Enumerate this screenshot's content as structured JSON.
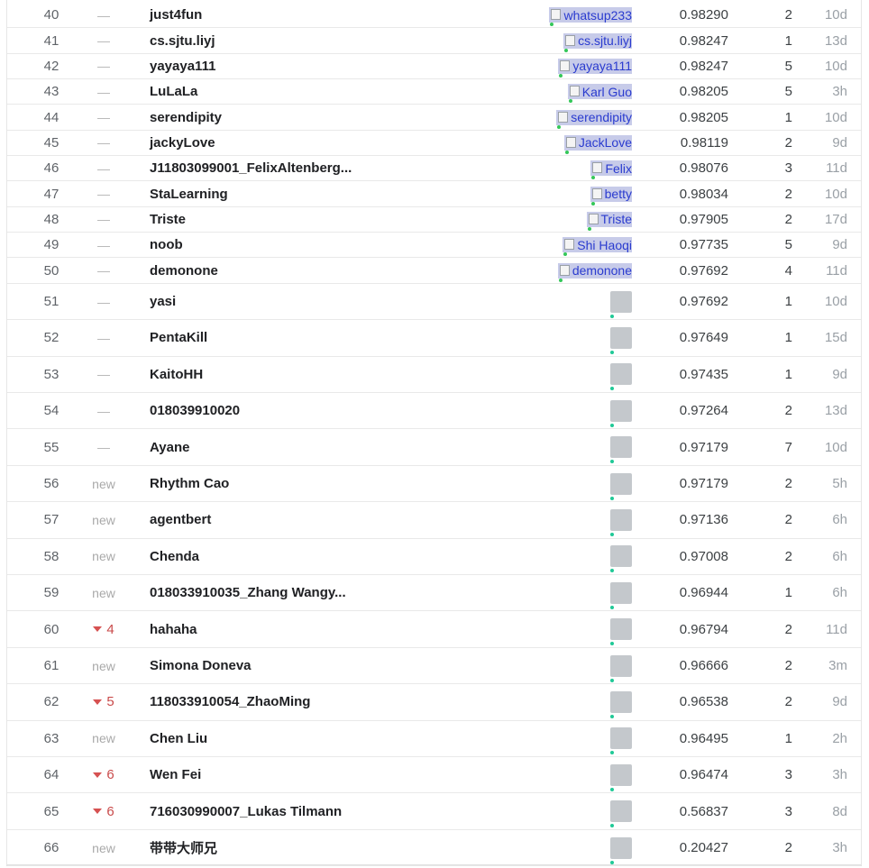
{
  "leaderboard": {
    "rows": [
      {
        "rank": "40",
        "change": "—",
        "team": "just4fun",
        "avatar_alt": "whatsup233",
        "score": "0.98290",
        "entries": "2",
        "last": "10d"
      },
      {
        "rank": "41",
        "change": "—",
        "team": "cs.sjtu.liyj",
        "avatar_alt": "cs.sjtu.liyj",
        "score": "0.98247",
        "entries": "1",
        "last": "13d"
      },
      {
        "rank": "42",
        "change": "—",
        "team": "yayaya111",
        "avatar_alt": "yayaya111",
        "score": "0.98247",
        "entries": "5",
        "last": "10d"
      },
      {
        "rank": "43",
        "change": "—",
        "team": "LuLaLa",
        "avatar_alt": "Karl Guo",
        "score": "0.98205",
        "entries": "5",
        "last": "3h"
      },
      {
        "rank": "44",
        "change": "—",
        "team": "serendipity",
        "avatar_alt": "serendipity",
        "score": "0.98205",
        "entries": "1",
        "last": "10d"
      },
      {
        "rank": "45",
        "change": "—",
        "team": "jackyLove",
        "avatar_alt": "JackLove",
        "score": "0.98119",
        "entries": "2",
        "last": "9d"
      },
      {
        "rank": "46",
        "change": "—",
        "team": "J11803099001_FelixAltenberg...",
        "avatar_alt": "Felix",
        "score": "0.98076",
        "entries": "3",
        "last": "11d"
      },
      {
        "rank": "47",
        "change": "—",
        "team": "StaLearning",
        "avatar_alt": "betty",
        "score": "0.98034",
        "entries": "2",
        "last": "10d"
      },
      {
        "rank": "48",
        "change": "—",
        "team": "Triste",
        "avatar_alt": "Triste",
        "score": "0.97905",
        "entries": "2",
        "last": "17d"
      },
      {
        "rank": "49",
        "change": "—",
        "team": "noob",
        "avatar_alt": "Shi Haoqi",
        "score": "0.97735",
        "entries": "5",
        "last": "9d"
      },
      {
        "rank": "50",
        "change": "—",
        "team": "demonone",
        "avatar_alt": "demonone",
        "score": "0.97692",
        "entries": "4",
        "last": "11d"
      },
      {
        "rank": "51",
        "change": "—",
        "team": "yasi",
        "avatar_alt": "",
        "score": "0.97692",
        "entries": "1",
        "last": "10d"
      },
      {
        "rank": "52",
        "change": "—",
        "team": "PentaKill",
        "avatar_alt": "",
        "score": "0.97649",
        "entries": "1",
        "last": "15d"
      },
      {
        "rank": "53",
        "change": "—",
        "team": "KaitoHH",
        "avatar_alt": "",
        "score": "0.97435",
        "entries": "1",
        "last": "9d"
      },
      {
        "rank": "54",
        "change": "—",
        "team": "018039910020",
        "avatar_alt": "",
        "score": "0.97264",
        "entries": "2",
        "last": "13d"
      },
      {
        "rank": "55",
        "change": "—",
        "team": "Ayane",
        "avatar_alt": "",
        "score": "0.97179",
        "entries": "7",
        "last": "10d"
      },
      {
        "rank": "56",
        "change": "new",
        "team": "Rhythm Cao",
        "avatar_alt": "",
        "score": "0.97179",
        "entries": "2",
        "last": "5h"
      },
      {
        "rank": "57",
        "change": "new",
        "team": "agentbert",
        "avatar_alt": "",
        "score": "0.97136",
        "entries": "2",
        "last": "6h"
      },
      {
        "rank": "58",
        "change": "new",
        "team": "Chenda",
        "avatar_alt": "",
        "score": "0.97008",
        "entries": "2",
        "last": "6h"
      },
      {
        "rank": "59",
        "change": "new",
        "team": "018033910035_Zhang Wangy...",
        "avatar_alt": "",
        "score": "0.96944",
        "entries": "1",
        "last": "6h"
      },
      {
        "rank": "60",
        "change": "4",
        "change_dir": "down",
        "team": "hahaha",
        "avatar_alt": "",
        "score": "0.96794",
        "entries": "2",
        "last": "11d"
      },
      {
        "rank": "61",
        "change": "new",
        "team": "Simona Doneva",
        "avatar_alt": "",
        "score": "0.96666",
        "entries": "2",
        "last": "3m"
      },
      {
        "rank": "62",
        "change": "5",
        "change_dir": "down",
        "team": "118033910054_ZhaoMing",
        "avatar_alt": "",
        "score": "0.96538",
        "entries": "2",
        "last": "9d"
      },
      {
        "rank": "63",
        "change": "new",
        "team": "Chen Liu",
        "avatar_alt": "",
        "score": "0.96495",
        "entries": "1",
        "last": "2h"
      },
      {
        "rank": "64",
        "change": "6",
        "change_dir": "down",
        "team": "Wen Fei",
        "avatar_alt": "",
        "score": "0.96474",
        "entries": "3",
        "last": "3h"
      },
      {
        "rank": "65",
        "change": "6",
        "change_dir": "down",
        "team": "716030990007_Lukas Tilmann",
        "avatar_alt": "",
        "score": "0.56837",
        "entries": "3",
        "last": "8d"
      },
      {
        "rank": "66",
        "change": "new",
        "team": "带带大师兄",
        "avatar_alt": "",
        "score": "0.20427",
        "entries": "2",
        "last": "3h"
      }
    ]
  }
}
